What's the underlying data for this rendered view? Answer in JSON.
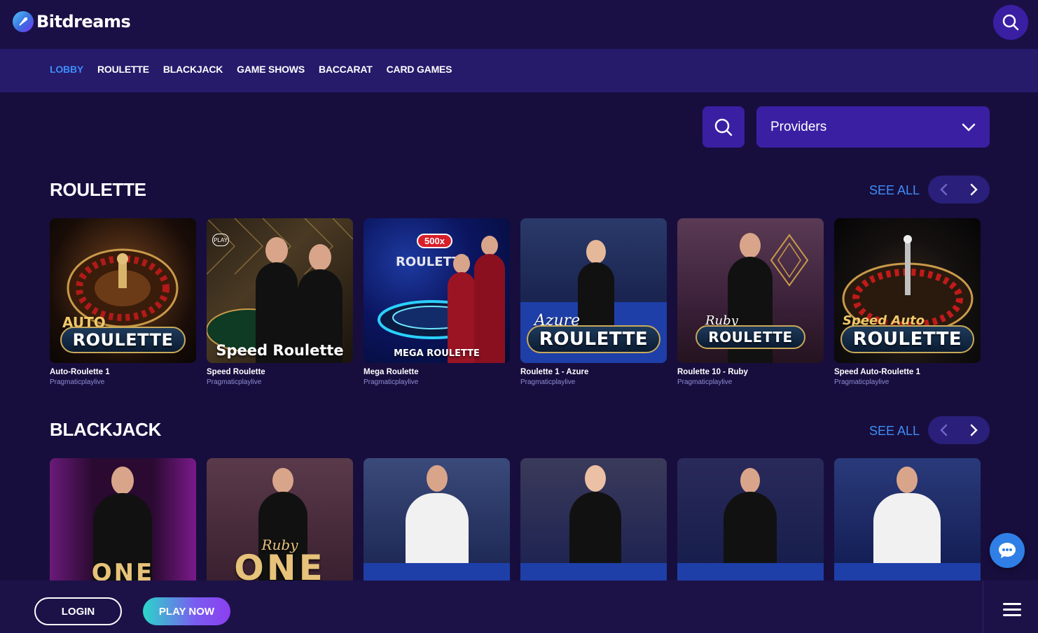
{
  "brand": {
    "name": "Bitdreams"
  },
  "nav": {
    "items": [
      {
        "label": "LOBBY",
        "active": true
      },
      {
        "label": "ROULETTE",
        "active": false
      },
      {
        "label": "BLACKJACK",
        "active": false
      },
      {
        "label": "GAME SHOWS",
        "active": false
      },
      {
        "label": "BACCARAT",
        "active": false
      },
      {
        "label": "CARD GAMES",
        "active": false
      }
    ]
  },
  "filter": {
    "providers_label": "Providers"
  },
  "sections": {
    "roulette": {
      "title": "ROULETTE",
      "see_all": "SEE ALL",
      "games": [
        {
          "name": "Auto-Roulette 1",
          "provider": "Pragmaticplaylive",
          "art_top": "AUTO",
          "art": "ROULETTE"
        },
        {
          "name": "Speed Roulette",
          "provider": "Pragmaticplaylive",
          "art_top": "",
          "art": "Speed Roulette",
          "badge": "PLAY"
        },
        {
          "name": "Mega Roulette",
          "provider": "Pragmaticplaylive",
          "art_top": "500x",
          "art": "MEGA ROULETTE",
          "art_mid": "ROULETTE"
        },
        {
          "name": "Roulette 1 - Azure",
          "provider": "Pragmaticplaylive",
          "art_top": "Azure",
          "art": "ROULETTE"
        },
        {
          "name": "Roulette 10 - Ruby",
          "provider": "Pragmaticplaylive",
          "art_top": "Ruby",
          "art": "ROULETTE"
        },
        {
          "name": "Speed Auto-Roulette 1",
          "provider": "Pragmaticplaylive",
          "art_top": "Speed Auto",
          "art": "ROULETTE"
        }
      ]
    },
    "blackjack": {
      "title": "BLACKJACK",
      "see_all": "SEE ALL",
      "games": [
        {
          "art": "ONE"
        },
        {
          "art_top": "Ruby",
          "art": "ONE"
        },
        {
          "art": ""
        },
        {
          "art": ""
        },
        {
          "art": ""
        },
        {
          "art": ""
        }
      ]
    }
  },
  "footer": {
    "login": "LOGIN",
    "play_now": "PLAY NOW"
  },
  "colors": {
    "accent": "#3e8ef7",
    "background": "#170e3e",
    "nav": "#261a6b",
    "button": "#3a1fa3"
  },
  "icons": [
    "logo-rocket-icon",
    "search-icon",
    "chevron-down-icon",
    "chevron-left-icon",
    "chevron-right-icon",
    "chat-icon",
    "menu-icon"
  ]
}
